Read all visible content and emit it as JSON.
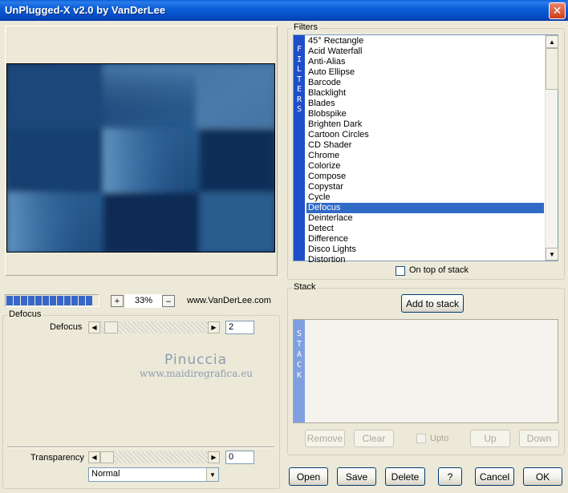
{
  "window": {
    "title": "UnPlugged-X v2.0 by VanDerLee",
    "close_glyph": "✕"
  },
  "preview": {
    "zoom": "33%",
    "zoom_plus": "+",
    "zoom_minus": "–",
    "website": "www.VanDerLee.com",
    "progress_blocks": 12
  },
  "filter_panel": {
    "group_label": "Defocus",
    "param_label": "Defocus",
    "param_value": "2",
    "transparency_label": "Transparency",
    "transparency_value": "0",
    "blend_mode": "Normal"
  },
  "watermark": {
    "line1": "Pinuccia",
    "line2": "www.maidiregrafica.eu"
  },
  "filters": {
    "group_label": "Filters",
    "strip_text": [
      "F",
      "I",
      "L",
      "T",
      "E",
      "R",
      "S"
    ],
    "items": [
      "45° Rectangle",
      "Acid Waterfall",
      "Anti-Alias",
      "Auto Ellipse",
      "Barcode",
      "Blacklight",
      "Blades",
      "Blobspike",
      "Brighten Dark",
      "Cartoon Circles",
      "CD Shader",
      "Chrome",
      "Colorize",
      "Compose",
      "Copystar",
      "Cycle",
      "Defocus",
      "Deinterlace",
      "Detect",
      "Difference",
      "Disco Lights",
      "Distortion"
    ],
    "selected_index": 16,
    "on_top_label": "On top of stack"
  },
  "stack": {
    "group_label": "Stack",
    "add_label": "Add to stack",
    "strip_text": [
      "S",
      "T",
      "A",
      "C",
      "K"
    ],
    "remove_label": "Remove",
    "clear_label": "Clear",
    "upto_label": "Upto",
    "up_label": "Up",
    "down_label": "Down"
  },
  "bottom_buttons": {
    "open": "Open",
    "save": "Save",
    "delete": "Delete",
    "help": "?",
    "cancel": "Cancel",
    "ok": "OK"
  },
  "colors": {
    "selection": "#316AC5",
    "filters_strip": "#1F4FC8",
    "stack_strip": "#7F9FE0"
  }
}
